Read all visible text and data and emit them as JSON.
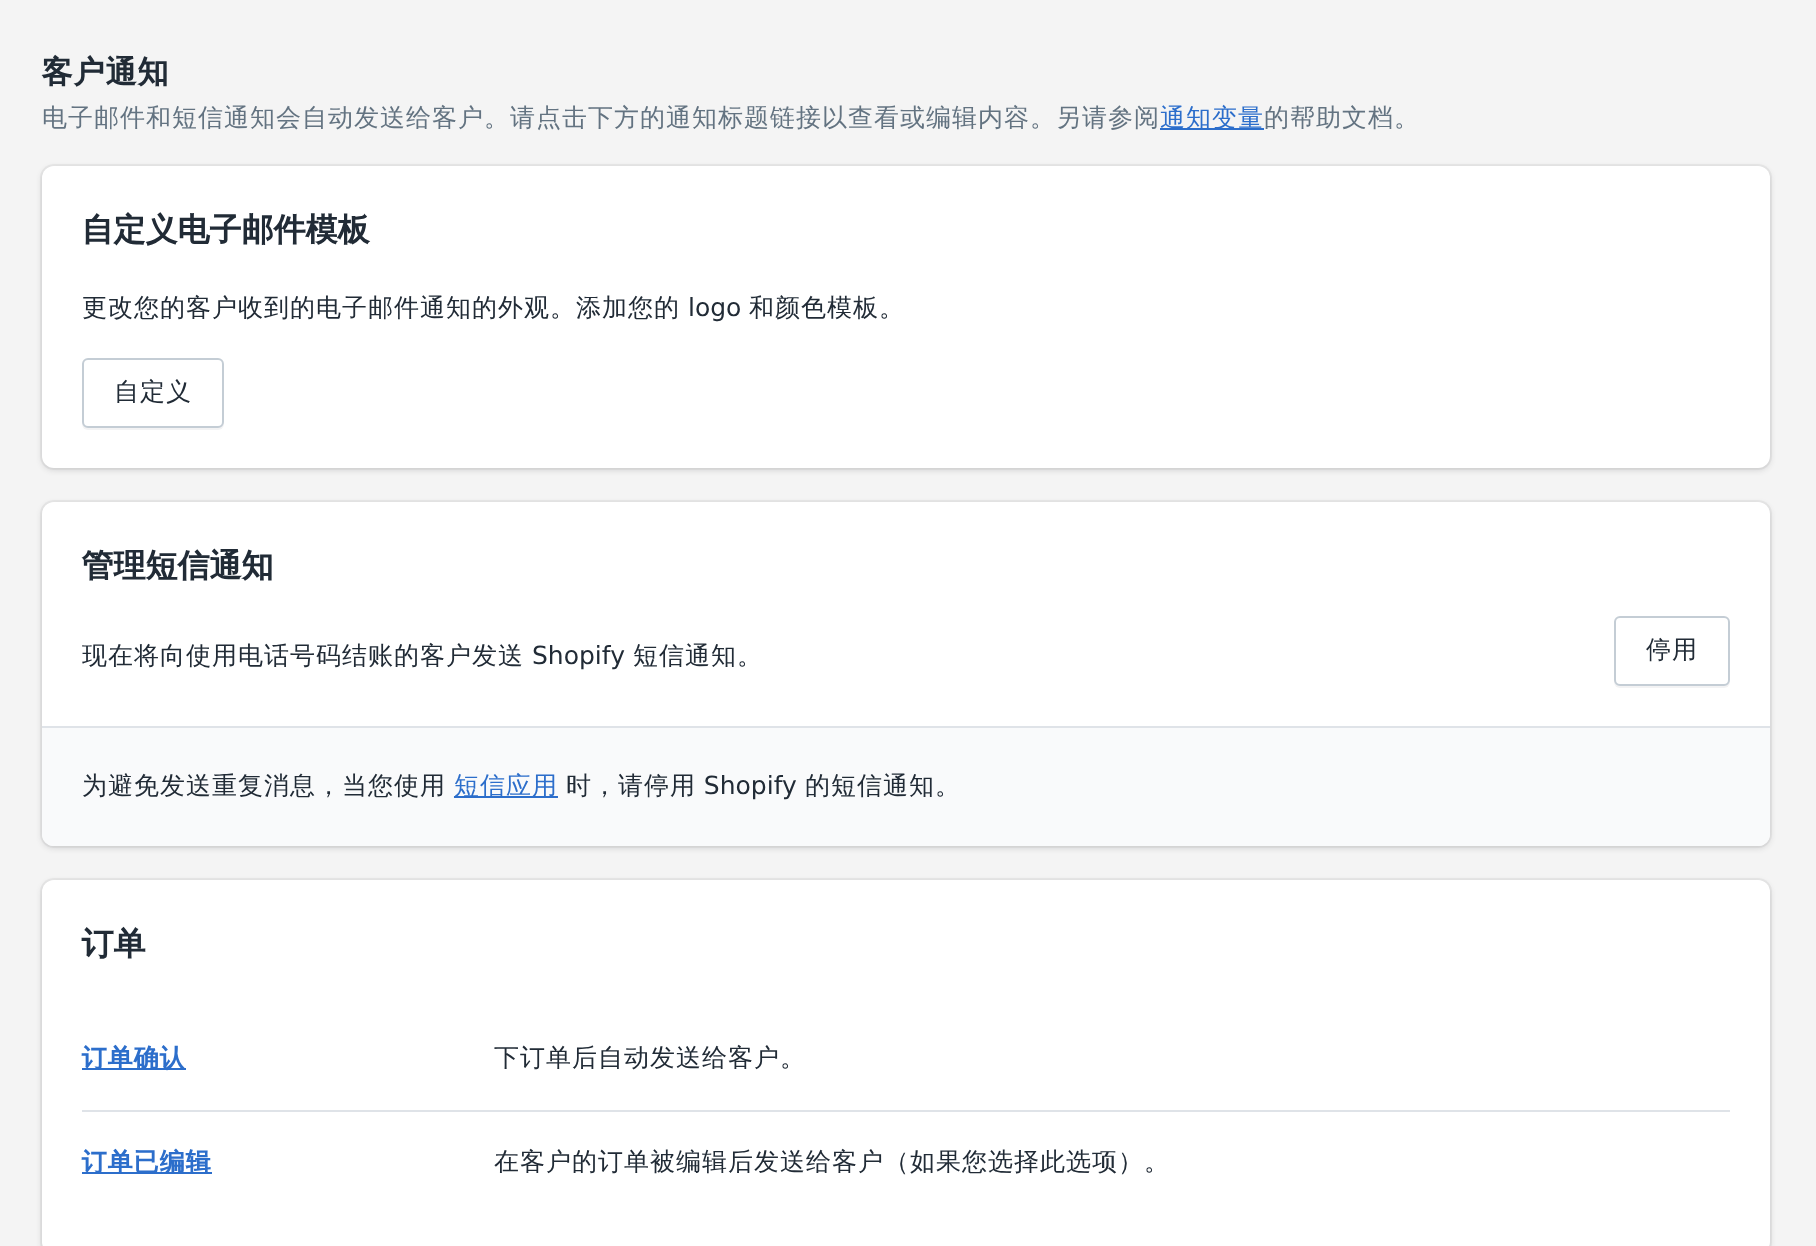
{
  "page": {
    "title": "客户通知",
    "intro": {
      "before": "电子邮件和短信通知会自动发送给客户。请点击下方的通知标题链接以查看或编辑内容。另请参阅",
      "link": "通知变量",
      "after": "的帮助文档。"
    }
  },
  "email_template": {
    "title": "自定义电子邮件模板",
    "description": "更改您的客户收到的电子邮件通知的外观。添加您的 logo 和颜色模板。",
    "button": "自定义"
  },
  "sms": {
    "title": "管理短信通知",
    "description": "现在将向使用电话号码结账的客户发送 Shopify 短信通知。",
    "button": "停用",
    "footer": {
      "before": "为避免发送重复消息，当您使用 ",
      "link": "短信应用",
      "after": " 时，请停用 Shopify 的短信通知。"
    }
  },
  "orders": {
    "title": "订单",
    "rows": [
      {
        "name": "订单确认",
        "description": "下订单后自动发送给客户。"
      },
      {
        "name": "订单已编辑",
        "description": "在客户的订单被编辑后发送给客户（如果您选择此选项）。"
      }
    ]
  }
}
